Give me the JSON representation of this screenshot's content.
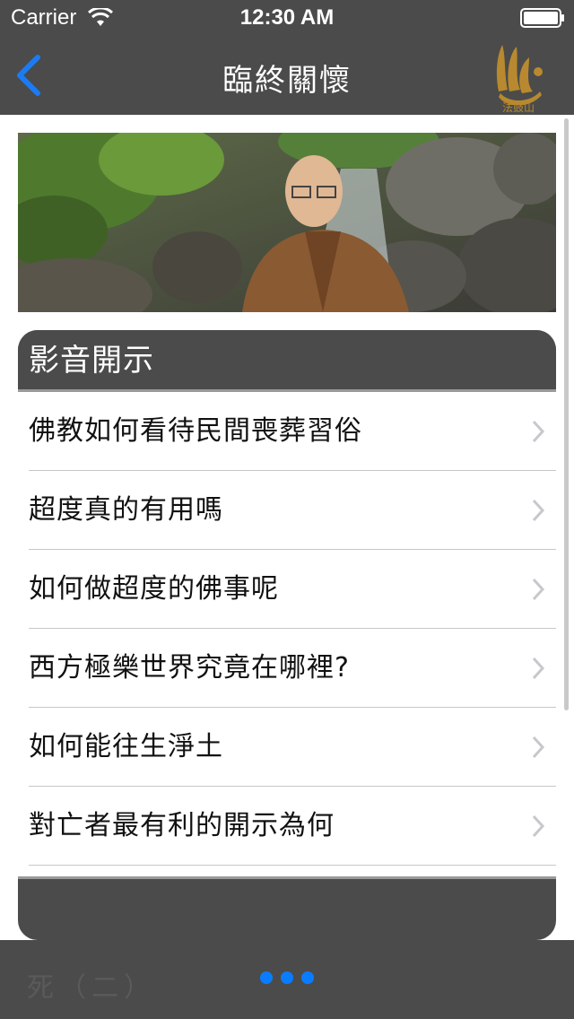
{
  "status_bar": {
    "carrier": "Carrier",
    "time": "12:30 AM"
  },
  "nav": {
    "title": "臨終關懷",
    "back_icon": "chevron-left-icon",
    "accent_color": "#1a7cf5",
    "logo_text": "法鼓山"
  },
  "banner": {
    "image": "monk-portrait-photo"
  },
  "section": {
    "header": "影音開示",
    "items": [
      {
        "label": "佛教如何看待民間喪葬習俗"
      },
      {
        "label": "超度真的有用嗎"
      },
      {
        "label": "如何做超度的佛事呢"
      },
      {
        "label": "西方極樂世界究竟在哪裡?"
      },
      {
        "label": "如何能往生淨土"
      },
      {
        "label": "對亡者最有利的開示為何"
      }
    ]
  },
  "bottom_bar": {
    "ghost_text": "死（二）",
    "page_dots": 3,
    "dot_color": "#0a7cff"
  },
  "colors": {
    "bar_background": "#4b4b4b",
    "list_background": "#ffffff",
    "separator": "#c8c8c8"
  }
}
